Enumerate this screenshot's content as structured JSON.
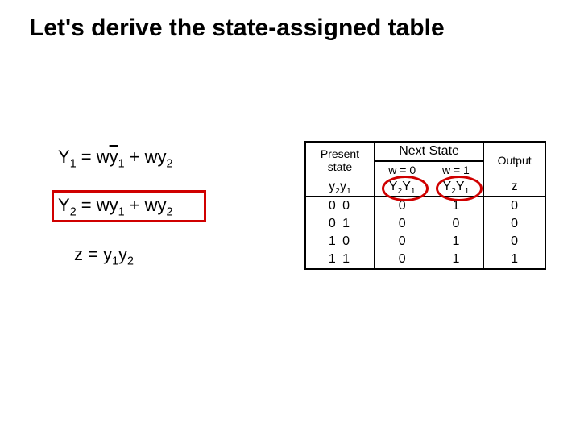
{
  "title": "Let's derive the state-assigned table",
  "equations": {
    "y1": {
      "lhs_var": "Y",
      "lhs_sub": "1",
      "eq": " = ",
      "t1a": "w",
      "t1b": "y",
      "t1sub": "1",
      "plus": " + ",
      "t2a": "wy",
      "t2sub": "2"
    },
    "y2": {
      "lhs_var": "Y",
      "lhs_sub": "2",
      "eq": " = ",
      "t1a": "wy",
      "t1sub": "1",
      "plus": " + ",
      "t2a": "wy",
      "t2sub": "2"
    },
    "z": {
      "lhs": "z = ",
      "t1a": "y",
      "t1sub": "1",
      "t2a": "y",
      "t2sub": "2"
    }
  },
  "table": {
    "present_label_l1": "Present",
    "present_label_l2": "state",
    "next_state_label": "Next State",
    "w0_label": "w = 0",
    "w1_label": "w = 1",
    "output_label": "Output",
    "y2y1_label_y": "y",
    "y2y1_label_2": "2",
    "y2y1_label_1": "1",
    "Y2Y1_label_Y": "Y",
    "Y2Y1_label_2": "2",
    "Y2Y1_label_1": "1",
    "z_label": "z",
    "rows": [
      {
        "ps": "0 0",
        "w0": "0",
        "w1": "1",
        "z": "0"
      },
      {
        "ps": "0 1",
        "w0": "0",
        "w1": "0",
        "z": "0"
      },
      {
        "ps": "1 0",
        "w0": "0",
        "w1": "1",
        "z": "0"
      },
      {
        "ps": "1 1",
        "w0": "0",
        "w1": "1",
        "z": "1"
      }
    ]
  }
}
